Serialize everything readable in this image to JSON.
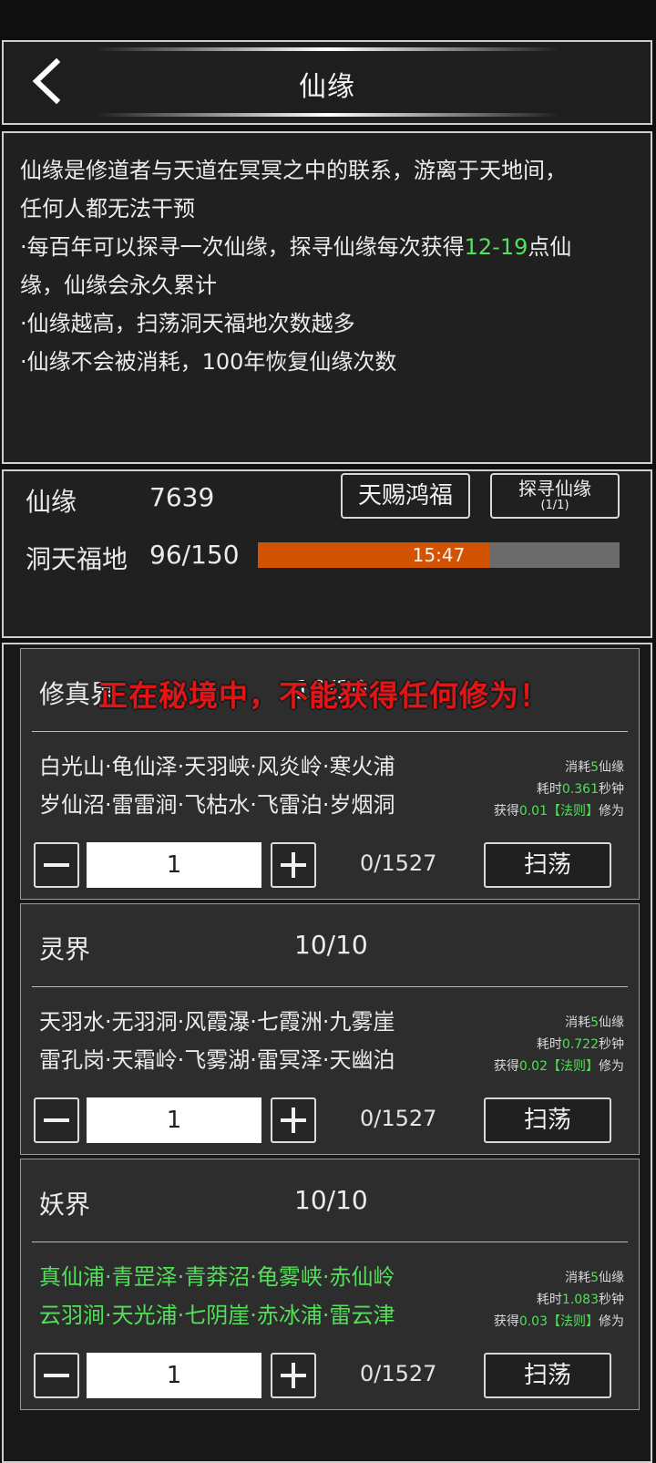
{
  "header": {
    "title": "仙缘",
    "back_icon": "chevron-left-icon"
  },
  "description": {
    "line1": "仙缘是修道者与天道在冥冥之中的联系，游离于天地间，",
    "line2": "任何人都无法干预",
    "line3_pre": "·每百年可以探寻一次仙缘，探寻仙缘每次获得",
    "line3_highlight": "12-19",
    "line3_post": "点仙",
    "line4": "缘，仙缘会永久累计",
    "line5": "·仙缘越高，扫荡洞天福地次数越多",
    "line6": "·仙缘不会被消耗，100年恢复仙缘次数",
    "highlight_color": "#53e05a"
  },
  "stats": {
    "xianyuan_label": "仙缘",
    "xianyuan_value": "7639",
    "blessing_button": "天赐鸿福",
    "explore_button": "探寻仙缘",
    "explore_sub": "(1/1)",
    "cave_label": "洞天福地",
    "cave_value": "96/150",
    "timer": "15:47",
    "timer_progress": 0.64,
    "progress_color": "#d25403"
  },
  "warning": "正在秘境中，不能获得任何修为！",
  "realms": [
    {
      "name": "修真界",
      "count": "10/10",
      "places_line1": "白光山·龟仙泽·天羽峡·风炎岭·寒火浦",
      "places_line2": "岁仙沼·雷雷涧·飞枯水·飞雷泊·岁烟洞",
      "cost_pre": "消耗",
      "cost_num": "5",
      "cost_post": "仙缘",
      "time_pre": "耗时",
      "time_num": "0.361",
      "time_post": "秒钟",
      "gain_pre": "获得",
      "gain_num": "0.01",
      "gain_tag": "【法则】",
      "gain_post": "修为",
      "qty": "1",
      "progress": "0/1527",
      "sweep": "扫荡"
    },
    {
      "name": "灵界",
      "count": "10/10",
      "places_line1": "天羽水·无羽洞·风霞瀑·七霞洲·九雾崖",
      "places_line2": "雷孔岗·天霜岭·飞雾湖·雷冥泽·天幽泊",
      "cost_pre": "消耗",
      "cost_num": "5",
      "cost_post": "仙缘",
      "time_pre": "耗时",
      "time_num": "0.722",
      "time_post": "秒钟",
      "gain_pre": "获得",
      "gain_num": "0.02",
      "gain_tag": "【法则】",
      "gain_post": "修为",
      "qty": "1",
      "progress": "0/1527",
      "sweep": "扫荡"
    },
    {
      "name": "妖界",
      "count": "10/10",
      "places_line1": "真仙浦·青罡泽·青莽沼·龟雾峡·赤仙岭",
      "places_line2": "云羽涧·天光浦·七阴崖·赤冰浦·雷云津",
      "cost_pre": "消耗",
      "cost_num": "5",
      "cost_post": "仙缘",
      "time_pre": "耗时",
      "time_num": "1.083",
      "time_post": "秒钟",
      "gain_pre": "获得",
      "gain_num": "0.03",
      "gain_tag": "【法则】",
      "gain_post": "修为",
      "qty": "1",
      "progress": "0/1527",
      "sweep": "扫荡"
    }
  ]
}
